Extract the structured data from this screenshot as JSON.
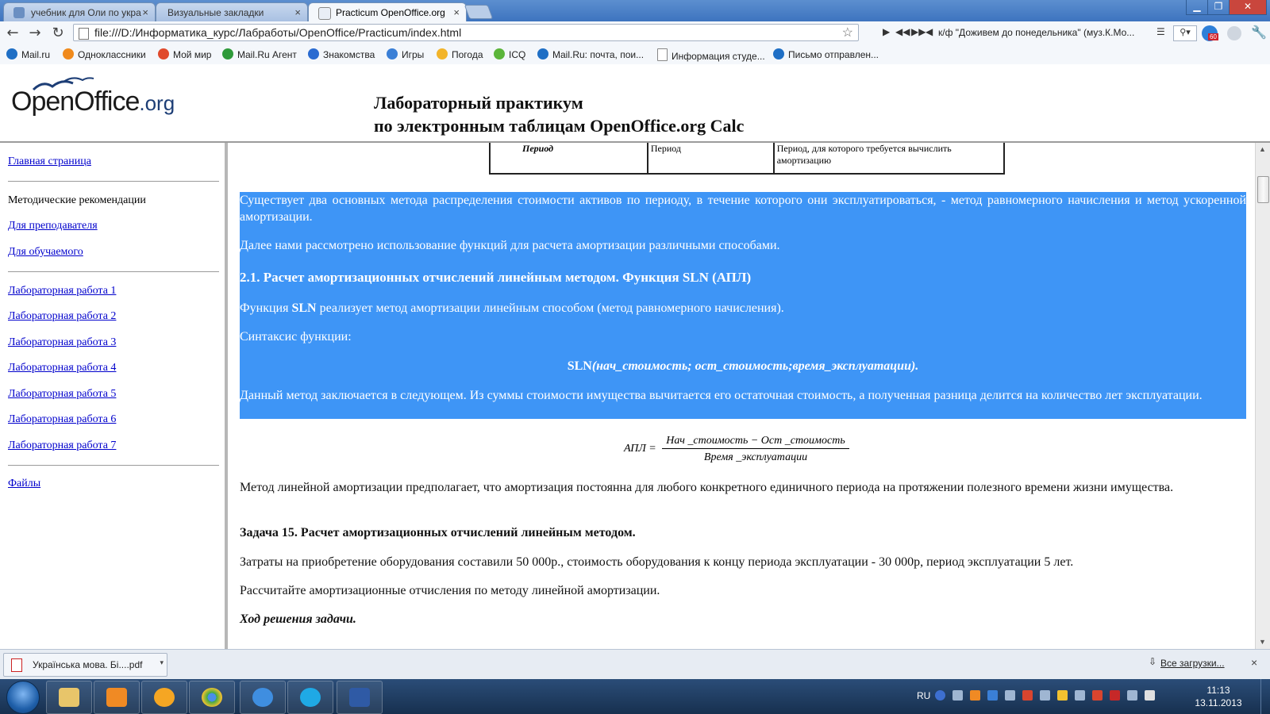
{
  "browser": {
    "tabs": [
      {
        "label": "учебник для Оли по укра",
        "active": false
      },
      {
        "label": "Визуальные закладки",
        "active": false
      },
      {
        "label": "Practicum OpenOffice.org",
        "active": true
      }
    ],
    "url": "file:///D:/Информатика_курс/Лабработы/OpenOffice/Practicum/index.html",
    "media_track": "к/ф \"Доживем до понедельника\" (муз.К.Мо...",
    "badge_count": "60",
    "bookmarks": [
      {
        "label": "Mail.ru",
        "color": "#1f6fc5"
      },
      {
        "label": "Одноклассники",
        "color": "#f08a1c"
      },
      {
        "label": "Мой мир",
        "color": "#e04a2c"
      },
      {
        "label": "Mail.Ru Агент",
        "color": "#2e9a3a"
      },
      {
        "label": "Знакомства",
        "color": "#2a6bd1"
      },
      {
        "label": "Игры",
        "color": "#3a7fd6"
      },
      {
        "label": "Погода",
        "color": "#f2b42a"
      },
      {
        "label": "ICQ",
        "color": "#5bb53a"
      },
      {
        "label": "Mail.Ru: почта, пои...",
        "color": "#1f6fc5"
      },
      {
        "label": "Информация студе...",
        "color": "#dddddd"
      },
      {
        "label": "Письмо отправлен...",
        "color": "#1f6fc5"
      }
    ]
  },
  "header": {
    "logo_main": "OpenOffice",
    "logo_suffix": ".org",
    "title_line1": "Лабораторный практикум",
    "title_line2": "по электронным таблицам OpenOffice.org Calc"
  },
  "sidebar": {
    "home": "Главная страница",
    "methodical": "Методические рекомендации",
    "for_teacher": "Для преподавателя",
    "for_student": "Для обучаемого",
    "labs": [
      "Лабораторная работа 1",
      "Лабораторная работа 2",
      "Лабораторная работа 3",
      "Лабораторная работа 4",
      "Лабораторная работа 5",
      "Лабораторная работа 6",
      "Лабораторная работа 7"
    ],
    "files": "Файлы"
  },
  "content": {
    "table_row": {
      "c1": "Период",
      "c2": "Период",
      "c3": "Период, для которого требуется вычислить амортизацию"
    },
    "p1": "Существует два основных метода распределения стоимости активов по периоду, в течение которого они эксплуатироваться, - метод равномерного начисления и метод ускоренной амортизации.",
    "p2": "Далее нами рассмотрено использование функций для расчета амортизации различными способами.",
    "h1": "2.1. Расчет амортизационных отчислений линейным методом. Функция SLN (АПЛ)",
    "p3_a": "Функция ",
    "p3_b": "SLN",
    "p3_c": " реализует метод амортизации линейным способом (метод равномерного начисления).",
    "p4": "Синтаксис функции:",
    "syntax_a": "SLN",
    "syntax_b": "(нач_стоимость; ост_стоимость;время_эксплуатации).",
    "p5": "Данный метод заключается в следующем. Из суммы стоимости имущества вычитается его остаточная стоимость, а полученная разница делится на количество лет эксплуатации.",
    "formula_lhs": "АПЛ =",
    "formula_num": "Нач _стоимость − Ост _стоимость",
    "formula_den": "Время _эксплуатации",
    "p6": "Метод линейной амортизации предполагает, что амортизация постоянна для любого конкретного единичного периода на протяжении полезного времени жизни имущества.",
    "task": "Задача 15. Расчет амортизационных отчислений линейным методом.",
    "p7": "Затраты на приобретение оборудования составили 50 000р., стоимость оборудования к концу периода эксплуатации - 30 000р, период эксплуатации 5 лет.",
    "p8": "Рассчитайте амортизационные отчисления по методу линейной амортизации.",
    "solution": "Ход решения задачи."
  },
  "downloads": {
    "item": "Українська мова. Бі....pdf",
    "all": "Все загрузки..."
  },
  "taskbar": {
    "lang": "RU",
    "time": "11:13",
    "date": "13.11.2013"
  }
}
